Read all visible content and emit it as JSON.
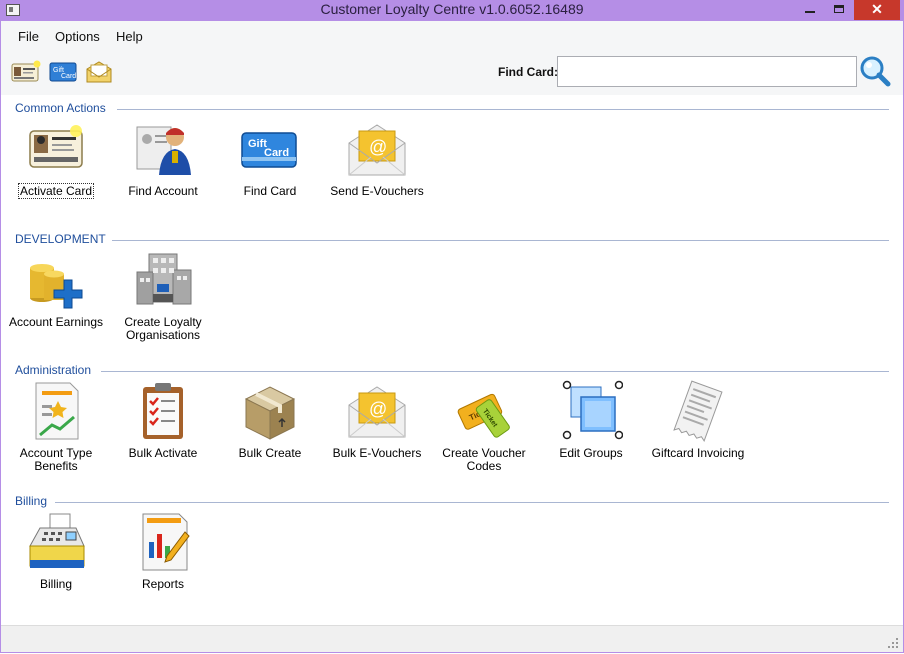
{
  "window": {
    "title": "Customer Loyalty Centre v1.0.6052.16489"
  },
  "menu": [
    "File",
    "Options",
    "Help"
  ],
  "toolbar": {
    "icons": [
      "activate-card-icon",
      "gift-card-icon",
      "e-voucher-icon"
    ],
    "find_label": "Find Card:",
    "find_value": "",
    "find_icon": "magnifier-icon"
  },
  "sections": [
    {
      "title": "Common Actions",
      "items": [
        {
          "label": "Activate Card",
          "icon": "id-card-icon"
        },
        {
          "label": "Find Account",
          "icon": "user-account-icon"
        },
        {
          "label": "Find Card",
          "icon": "gift-card-icon"
        },
        {
          "label": "Send E-Vouchers",
          "icon": "envelope-icon"
        }
      ]
    },
    {
      "title": "DEVELOPMENT",
      "items": [
        {
          "label": "Account Earnings",
          "icon": "coins-plus-icon"
        },
        {
          "label": "Create Loyalty Organisations",
          "icon": "building-icon"
        }
      ]
    },
    {
      "title": "Administration",
      "items": [
        {
          "label": "Account Type Benefits",
          "icon": "benefits-chart-icon"
        },
        {
          "label": "Bulk Activate",
          "icon": "clipboard-checklist-icon"
        },
        {
          "label": "Bulk Create",
          "icon": "box-icon"
        },
        {
          "label": "Bulk E-Vouchers",
          "icon": "envelope-icon"
        },
        {
          "label": "Create Voucher Codes",
          "icon": "tickets-icon"
        },
        {
          "label": "Edit Groups",
          "icon": "group-selection-icon"
        },
        {
          "label": "Giftcard Invoicing",
          "icon": "invoice-icon"
        }
      ]
    },
    {
      "title": "Billing",
      "items": [
        {
          "label": "Billing",
          "icon": "cash-register-icon"
        },
        {
          "label": "Reports",
          "icon": "report-chart-icon"
        }
      ]
    }
  ],
  "colors": {
    "titlebar": "#b58ee6",
    "section_title": "#1f4e9c",
    "close_button": "#c7382b"
  }
}
